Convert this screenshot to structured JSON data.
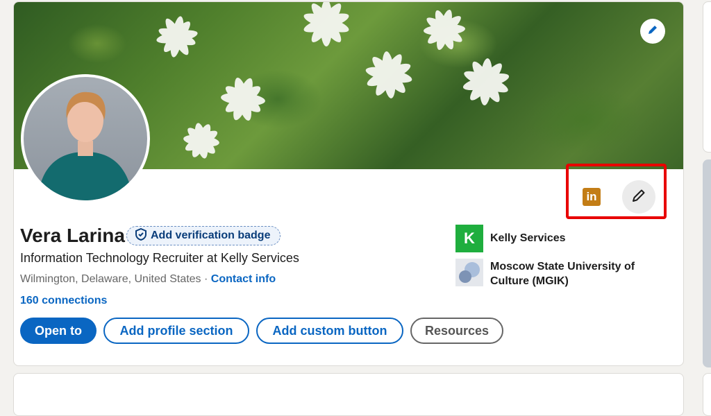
{
  "profile": {
    "name": "Vera Larina",
    "verification_label": "Add verification badge",
    "headline": "Information Technology Recruiter at Kelly Services",
    "location": "Wilmington, Delaware, United States",
    "separator": "·",
    "contact_info_label": "Contact info",
    "connections": "160 connections"
  },
  "actions": {
    "open_to": "Open to",
    "add_profile_section": "Add profile section",
    "add_custom_button": "Add custom button",
    "resources": "Resources"
  },
  "organizations": [
    {
      "name": "Kelly Services",
      "logo_letter": "K",
      "logo_color": "#1fae3e"
    },
    {
      "name": "Moscow State University of Culture (MGIK)",
      "logo_color": "#b9c9e0"
    }
  ],
  "badges": {
    "linkedin_logo_text": "in"
  },
  "icons": {
    "banner_edit": "pencil-icon",
    "profile_edit": "pencil-icon",
    "verify": "shield-check-icon"
  },
  "colors": {
    "primary": "#0a66c2",
    "highlight": "#e80000",
    "linkedin_badge": "#c37d16"
  }
}
